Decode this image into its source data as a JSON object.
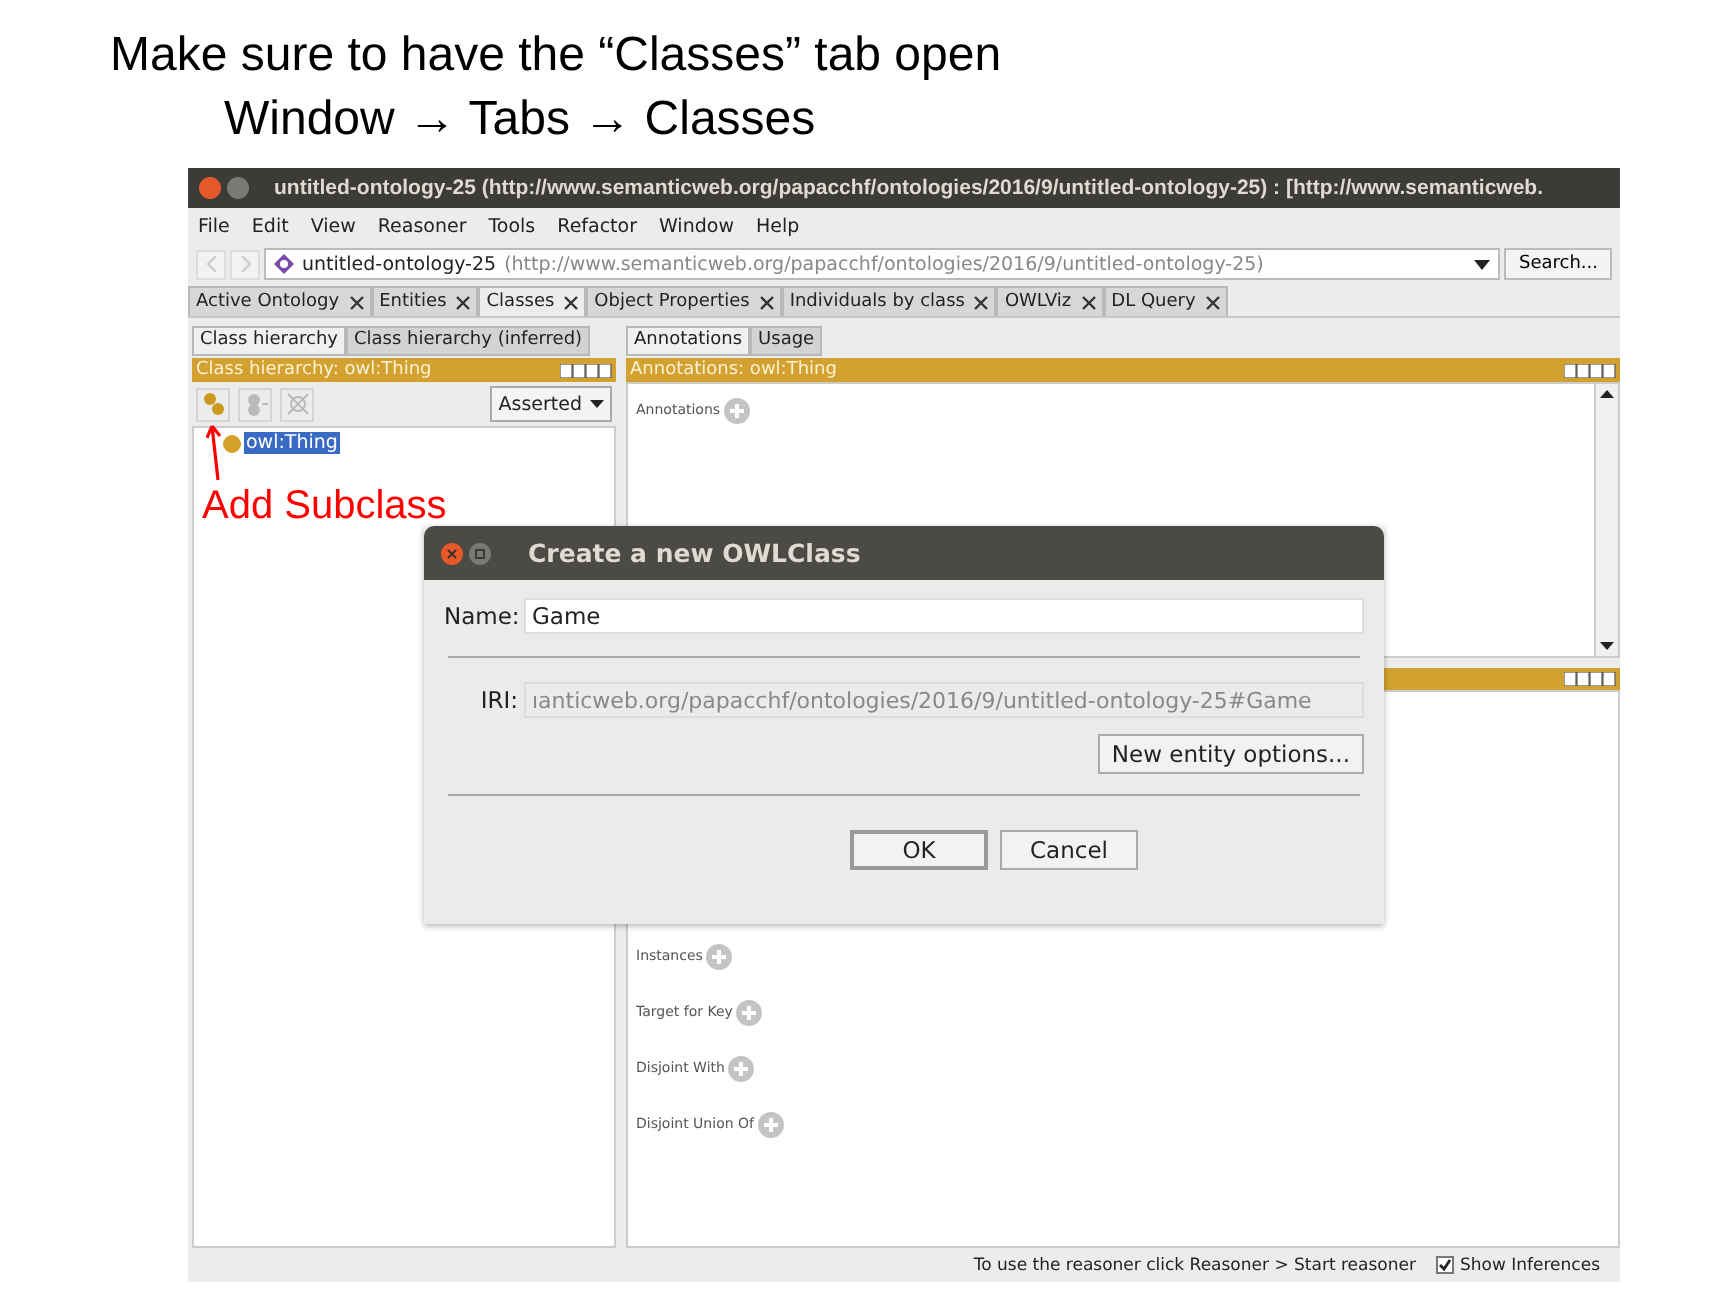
{
  "slide": {
    "heading": "Make sure to have the “Classes” tab open",
    "path": "Window → Tabs → Classes"
  },
  "window": {
    "title": "untitled-ontology-25 (http://www.semanticweb.org/papacchf/ontologies/2016/9/untitled-ontology-25)  : [http://www.semanticweb."
  },
  "menu": [
    "File",
    "Edit",
    "View",
    "Reasoner",
    "Tools",
    "Refactor",
    "Window",
    "Help"
  ],
  "address": {
    "name": "untitled-ontology-25",
    "iri": "(http://www.semanticweb.org/papacchf/ontologies/2016/9/untitled-ontology-25)",
    "search": "Search..."
  },
  "tabs": [
    {
      "label": "Active Ontology",
      "selected": false
    },
    {
      "label": "Entities",
      "selected": false
    },
    {
      "label": "Classes",
      "selected": true
    },
    {
      "label": "Object Properties",
      "selected": false
    },
    {
      "label": "Individuals by class",
      "selected": false
    },
    {
      "label": "OWLViz",
      "selected": false
    },
    {
      "label": "DL Query",
      "selected": false
    }
  ],
  "left": {
    "tabs": [
      {
        "label": "Class hierarchy",
        "selected": true
      },
      {
        "label": "Class hierarchy (inferred)",
        "selected": false
      }
    ],
    "header": "Class hierarchy: owl:Thing",
    "mode": "Asserted",
    "tree": [
      {
        "label": "owl:Thing",
        "selected": true
      }
    ]
  },
  "right": {
    "tabs": [
      {
        "label": "Annotations",
        "selected": true
      },
      {
        "label": "Usage",
        "selected": false
      }
    ],
    "header": "Annotations: owl:Thing",
    "sections": [
      "Annotations"
    ],
    "lower_sections": [
      "Instances",
      "Target for Key",
      "Disjoint With",
      "Disjoint Union Of"
    ]
  },
  "callout": "Add Subclass",
  "dialog": {
    "title": "Create a new OWLClass",
    "name_label": "Name:",
    "name_value": "Game",
    "iri_label": "IRI:",
    "iri_value": "ıanticweb.org/papacchf/ontologies/2016/9/untitled-ontology-25#Game",
    "options_button": "New entity options...",
    "buttons": [
      "OK",
      "Cancel"
    ]
  },
  "status": {
    "text": "To use the reasoner click Reasoner > Start reasoner",
    "checkbox": {
      "label": "Show Inferences",
      "checked": true
    }
  }
}
